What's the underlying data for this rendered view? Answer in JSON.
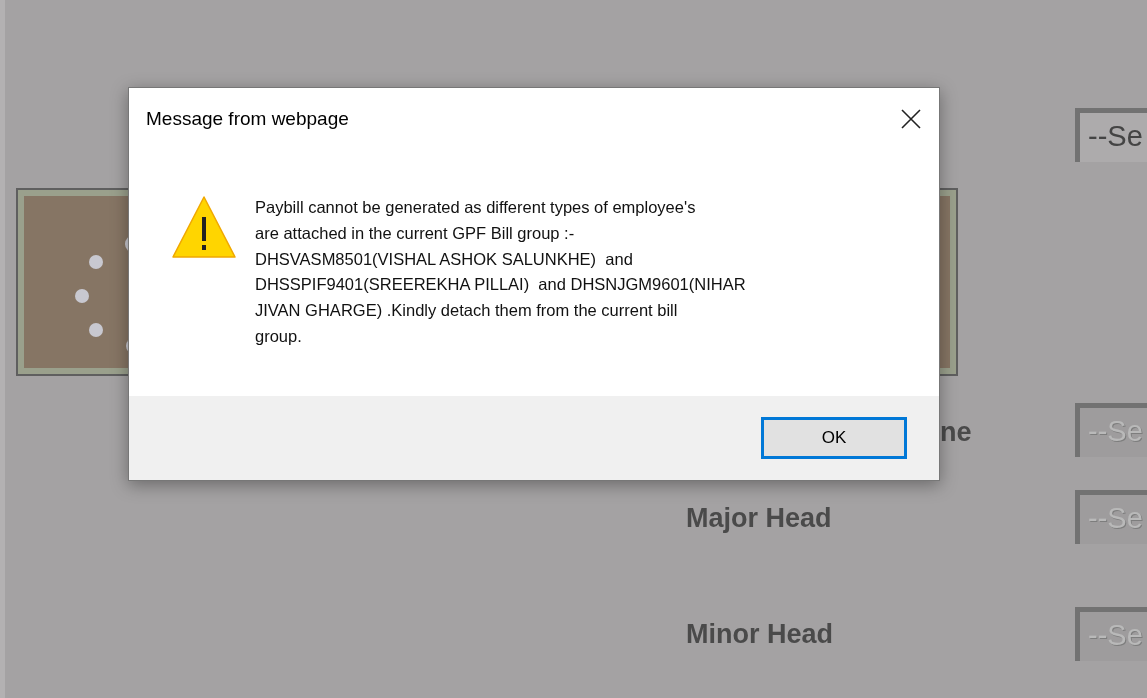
{
  "page": {
    "labels": [
      {
        "text": "ne"
      },
      {
        "text": "Major Head"
      },
      {
        "text": "Minor Head"
      }
    ],
    "selects": [
      {
        "text": "--Se",
        "disabled": false
      },
      {
        "text": "--Se",
        "disabled": true
      },
      {
        "text": "--Se",
        "disabled": true
      },
      {
        "text": "--Se",
        "disabled": true
      }
    ]
  },
  "dialog": {
    "title": "Message from webpage",
    "message": "Paybill cannot be generated as different types of employee's\nare attached in the current GPF Bill group :-\nDHSVASM8501(VISHAL ASHOK SALUNKHE)  and\nDHSSPIF9401(SREEREKHA PILLAI)  and DHSNJGM9601(NIHAR\nJIVAN GHARGE) .Kindly detach them from the current bill\ngroup.",
    "buttons": [
      {
        "label": "OK",
        "focused": true
      }
    ]
  }
}
